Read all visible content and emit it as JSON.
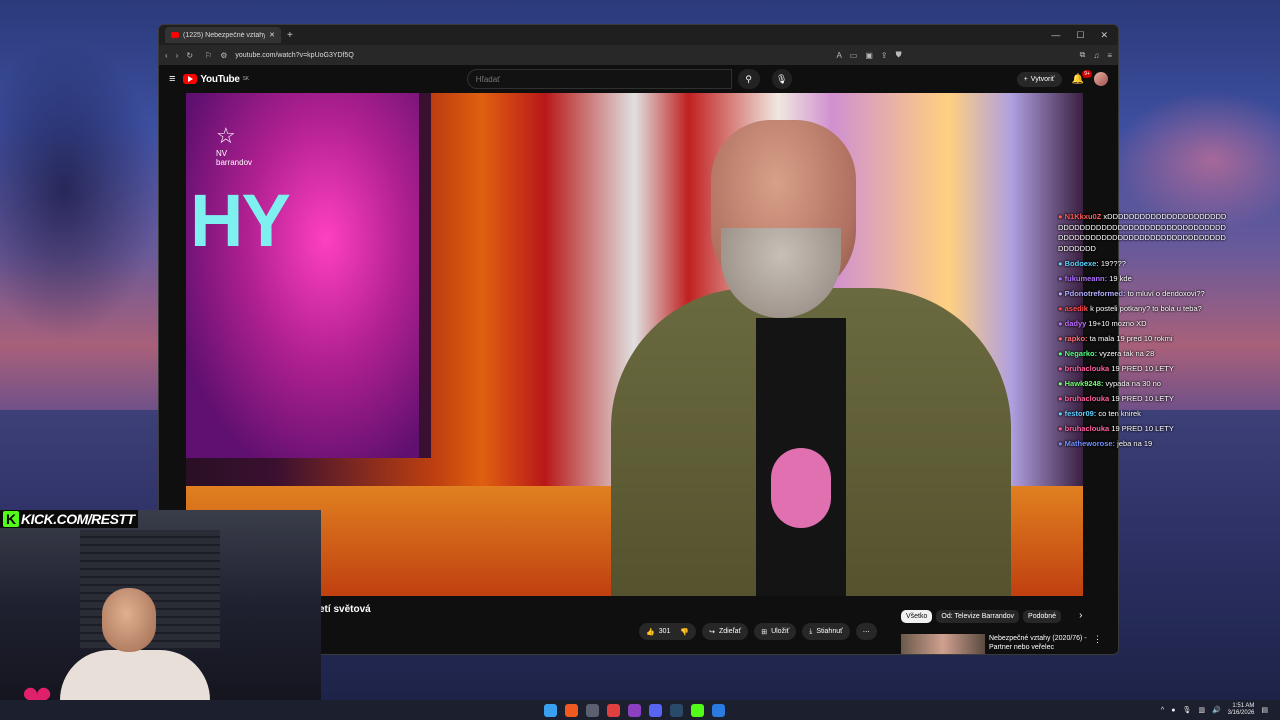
{
  "browser": {
    "tab_title": "(1225) Nebezpečné vztahy (2(",
    "url": "youtube.com/watch?v=kpUoG3YDf5Q"
  },
  "youtube": {
    "logo_text": "YouTube",
    "logo_region": "SK",
    "search_placeholder": "Hľadať",
    "create_label": "Vytvoriť",
    "notification_count": "9+"
  },
  "video": {
    "title_fragment": "etí světová",
    "channel_logo_line1": "NV",
    "channel_logo_line2": "barrandov",
    "screen_text": "HY",
    "likes": "301",
    "share_label": "Zdieľať",
    "save_label": "Uložiť",
    "download_label": "Stiahnuť"
  },
  "related": {
    "chips": [
      "Všetko",
      "Od: Televize Barrandov",
      "Podobné"
    ],
    "first_title_line1": "Nebezpečné vztahy (2020/76) -",
    "first_title_line2": "Partner nebo veřelec"
  },
  "chat": [
    {
      "user": "N1Kkxu0Z",
      "color": "#ff5a5a",
      "text": "xDDDDDDDDDDDDDDDDDDDDDDDDDDDDDDDDDDDDDDDDDDDDDDDDDDDDDDDDDDDDDDDDDDDDDDDDDDDDDDDDDDDDDDDDDDD"
    },
    {
      "user": "Bodoexe:",
      "color": "#58d4ff",
      "text": "19????"
    },
    {
      "user": "fukumeann:",
      "color": "#b070ff",
      "text": "19 kde"
    },
    {
      "user": "Pdonotreformed:",
      "color": "#b0b0ff",
      "text": "to mluví o dendoxovi??"
    },
    {
      "user": "asedik",
      "color": "#ff4a4a",
      "text": "k posteli potkany? to bola u teba?"
    },
    {
      "user": "dadyy",
      "color": "#c070ff",
      "text": "19+10 mozno XD"
    },
    {
      "user": "rapko:",
      "color": "#ff7070",
      "text": "ta mala 19 pred 10 rokmi"
    },
    {
      "user": "Negarko:",
      "color": "#50ff80",
      "text": "vyzera tak na 28"
    },
    {
      "user": "bruhaclouka",
      "color": "#ff60a0",
      "text": "19 PRED 10 LETY"
    },
    {
      "user": "Hawk9248:",
      "color": "#70ff70",
      "text": "vypada na 30 no"
    },
    {
      "user": "bruhaclouka",
      "color": "#ff60a0",
      "text": "19 PRED 10 LETY"
    },
    {
      "user": "festor09:",
      "color": "#60d0ff",
      "text": "co ten knirek"
    },
    {
      "user": "bruhaclouka",
      "color": "#ff60a0",
      "text": "19 PRED 10 LETY"
    },
    {
      "user": "Matheworose:",
      "color": "#7090ff",
      "text": "jeba na 19"
    }
  ],
  "overlay": {
    "kick_letter": "K",
    "kick_text": "KICK.COM/RESTT"
  },
  "taskbar": {
    "time": "1:51 AM",
    "date": "3/16/2026"
  }
}
